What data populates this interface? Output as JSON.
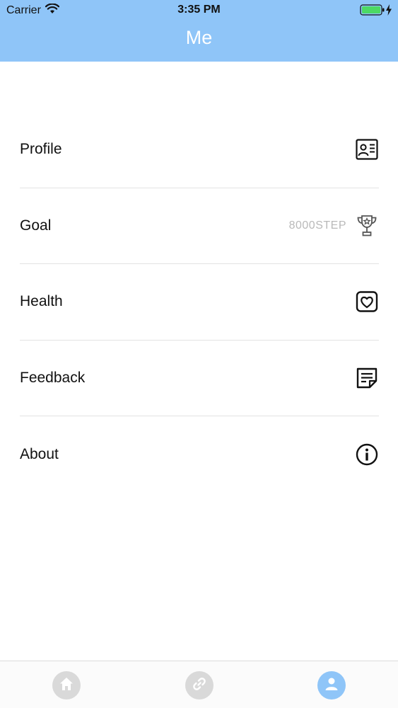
{
  "status_bar": {
    "carrier": "Carrier",
    "time": "3:35 PM"
  },
  "header": {
    "title": "Me",
    "color": "#8fc5f8"
  },
  "menu": {
    "items": [
      {
        "label": "Profile",
        "icon": "profile-card-icon"
      },
      {
        "label": "Goal",
        "value": "8000STEP",
        "icon": "trophy-icon"
      },
      {
        "label": "Health",
        "icon": "heart-icon"
      },
      {
        "label": "Feedback",
        "icon": "note-icon"
      },
      {
        "label": "About",
        "icon": "info-icon"
      }
    ]
  },
  "tabbar": {
    "tabs": [
      {
        "icon": "home-icon",
        "active": false
      },
      {
        "icon": "link-icon",
        "active": false
      },
      {
        "icon": "user-icon",
        "active": true
      }
    ],
    "active_color": "#8fc5f8",
    "inactive_color": "#d9d9d9"
  }
}
